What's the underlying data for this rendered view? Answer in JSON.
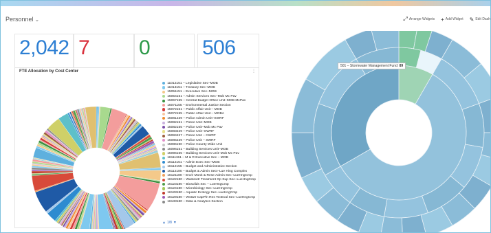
{
  "header": {
    "title": "Personnel",
    "toolbar": {
      "arrange": "Arrange Widgets",
      "add": "Add Widget",
      "edit": "Edit Dash"
    }
  },
  "kpis": [
    {
      "value": "2,042",
      "color": "#2d7fd3"
    },
    {
      "value": "7",
      "color": "#d9303c"
    },
    {
      "value": "0",
      "color": "#2e9a4a"
    },
    {
      "value": "506",
      "color": "#2d7fd3"
    }
  ],
  "fte_panel": {
    "title": "FTE Allocation by Cost Center",
    "pager": "1/8",
    "legend": [
      {
        "label": "11012151 – Legislative Sec–MOB",
        "color": "#5eb0de"
      },
      {
        "label": "11013151 – Treasury Sec–MOB",
        "color": "#7fc9ee"
      },
      {
        "label": "15051151 – Executive Sec–MOB",
        "color": "#f4c98a"
      },
      {
        "label": "15054151 – Admin Services Sec–Mob Mc Pav",
        "color": "#a8d98e"
      },
      {
        "label": "15067155 – Central Budget Office Unit–MOB McPav",
        "color": "#3a8f3e"
      },
      {
        "label": "15071155 – Environmental Justice Section",
        "color": "#f39d9c"
      },
      {
        "label": "15072151 – Public Affair Unit – MOB",
        "color": "#d33b3b"
      },
      {
        "label": "15072155 – Public Affair Unit – MOBA",
        "color": "#f9c69f"
      },
      {
        "label": "15081239 – Police Admin Unit–SWRF",
        "color": "#f08a2c"
      },
      {
        "label": "15082151 – Police Unit–MOB",
        "color": "#c9b0de"
      },
      {
        "label": "15082155 – Police Unit–Mob Mc Pav",
        "color": "#7b4ea8"
      },
      {
        "label": "15083229 – Police Unit–OWRF",
        "color": "#e8e08a"
      },
      {
        "label": "15084227 – Police Unit – CWRF",
        "color": "#9c5d3c"
      },
      {
        "label": "15085239 – Police Unit – SWRF",
        "color": "#e28fc8"
      },
      {
        "label": "15086190 – Police County Wide Unit",
        "color": "#c6c6c6"
      },
      {
        "label": "15096151 – Building Services Unit–MOB",
        "color": "#8a8a8a"
      },
      {
        "label": "15096155 – Building Services Unit–Mob Mc Pav",
        "color": "#cfd068"
      },
      {
        "label": "16111151 – M & R Executive Sec – MOB",
        "color": "#5ec0c9"
      },
      {
        "label": "16112151 – Admin Exec Sec–MOB",
        "color": "#2d8bd0"
      },
      {
        "label": "16112155 – Budget and Administrative Section",
        "color": "#a4c8ea"
      },
      {
        "label": "16112180 – Budget & Admin Sect–Lue Hing Complex",
        "color": "#1f5aa6"
      },
      {
        "label": "16121180 – Envir Monit & Rese Admin Sec–LueHngCmp",
        "color": "#f0a05a"
      },
      {
        "label": "16122180 – Wastewtr Treatment Op Sup Sec–LueHngCmp",
        "color": "#d84a3a"
      },
      {
        "label": "16123180 – Biosolids Sec – LueHngCmp",
        "color": "#4f9c4a"
      },
      {
        "label": "16124180 – Microbiology Sec–LueHngCmp",
        "color": "#a6c85a"
      },
      {
        "label": "16128180 – Aquatic Ecology Sec–LueHngCmp",
        "color": "#c0392b"
      },
      {
        "label": "16129180 – Wstwtr CapPln Res TecEval Sec–LueHngCmp",
        "color": "#9b59b6"
      },
      {
        "label": "16133180 – Data & Analytics Section",
        "color": "#8a8a8a"
      }
    ]
  },
  "sunburst": {
    "tooltip_label": "501 – Stormwater Management Fund:",
    "tooltip_value": "89"
  },
  "colors": {
    "accent": "#2d7fd3",
    "sunburst_base": "#8ab9d6"
  }
}
